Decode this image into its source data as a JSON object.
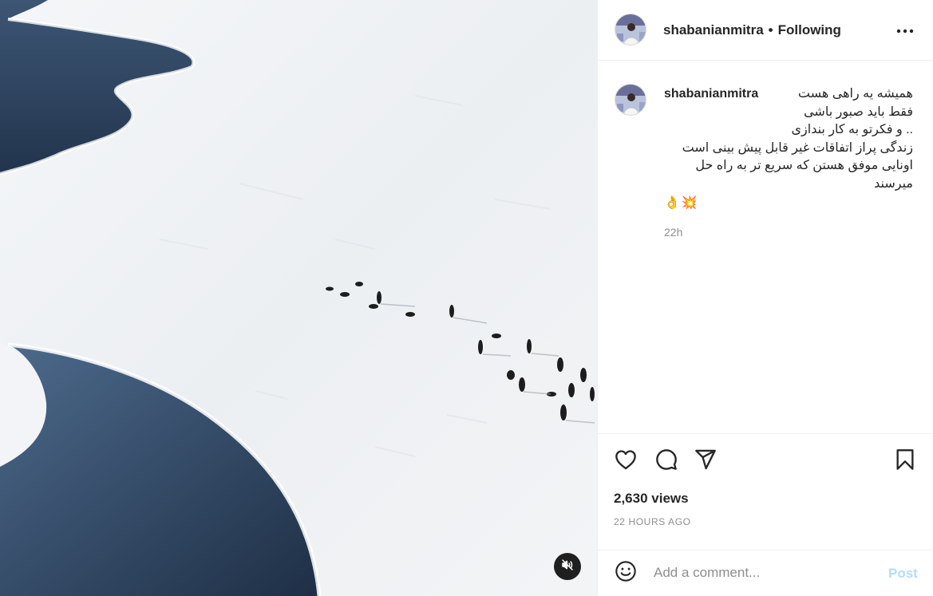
{
  "post": {
    "username": "shabanianmitra",
    "separator": "•",
    "follow_status": "Following",
    "caption_lines": [
      "همیشه یه راهی هست",
      "فقط باید صبور باشی",
      ".. و فکرتو به کار بندازی",
      "زندگی پراز اتفاقات غیر قابل پیش بینی است",
      "اونایی موفق هستن که سریع تر به راه حل",
      "میرسند"
    ],
    "caption_emoji": [
      "👌",
      "💥"
    ],
    "caption_time": "22h",
    "views": "2,630 views",
    "posted_ago": "22 HOURS AGO"
  },
  "comment": {
    "placeholder": "Add a comment...",
    "post_label": "Post"
  },
  "icons": {
    "more": "more-horizontal-icon",
    "like": "heart-icon",
    "comment": "comment-bubble-icon",
    "share": "paper-plane-icon",
    "save": "bookmark-icon",
    "emoji": "smiley-icon",
    "mute": "speaker-muted-icon"
  },
  "colors": {
    "text": "#262626",
    "muted": "#8e8e8e",
    "post_button_disabled": "#b3dbff",
    "divider": "#efefef"
  }
}
